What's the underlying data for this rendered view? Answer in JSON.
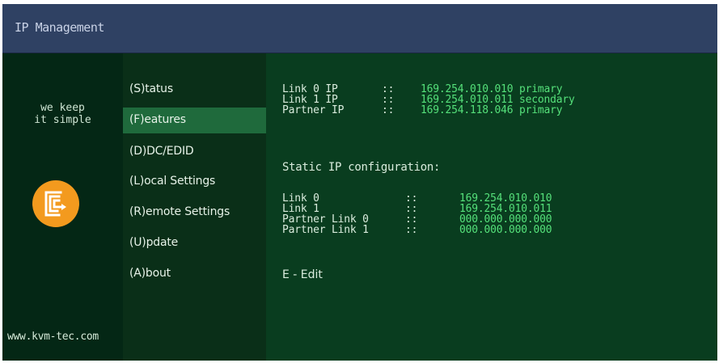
{
  "window": {
    "title": "IP Management"
  },
  "branding": {
    "slogan_line1": "we keep",
    "slogan_line2": "it simple",
    "website": "www.kvm-tec.com",
    "logo_icon": "kvm-tec-logo-icon",
    "logo_color": "#f39a1e"
  },
  "menu": {
    "items": [
      {
        "label": "(S)tatus",
        "selected": false
      },
      {
        "label": "(F)eatures",
        "selected": true
      },
      {
        "label": "(D)DC/EDID",
        "selected": false
      },
      {
        "label": "(L)ocal  Settings",
        "selected": false
      },
      {
        "label": "(R)emote Settings",
        "selected": false
      },
      {
        "label": "(U)pdate",
        "selected": false
      },
      {
        "label": "(A)bout",
        "selected": false
      }
    ]
  },
  "links": [
    {
      "label": "Link 0 IP",
      "sep": "::",
      "value": "169.254.010.010 primary"
    },
    {
      "label": "Link 1 IP",
      "sep": "::",
      "value": "169.254.010.011 secondary"
    },
    {
      "label": "Partner IP",
      "sep": "::",
      "value": "169.254.118.046 primary"
    }
  ],
  "static_config": {
    "title": "Static IP configuration:",
    "rows": [
      {
        "label": "Link 0",
        "sep": "::",
        "value": "169.254.010.010"
      },
      {
        "label": "Link 1",
        "sep": "::",
        "value": "169.254.010.011"
      },
      {
        "label": "Partner Link 0",
        "sep": "::",
        "value": "000.000.000.000"
      },
      {
        "label": "Partner Link 1",
        "sep": "::",
        "value": "000.000.000.000"
      }
    ]
  },
  "edit_hint": "E - Edit",
  "colors": {
    "title_bar": "#2f4163",
    "content_bg": "#093d1f",
    "menu_bg": "#0a2f18",
    "menu_selected": "#1f6a3c",
    "value_text": "#55e07a"
  }
}
